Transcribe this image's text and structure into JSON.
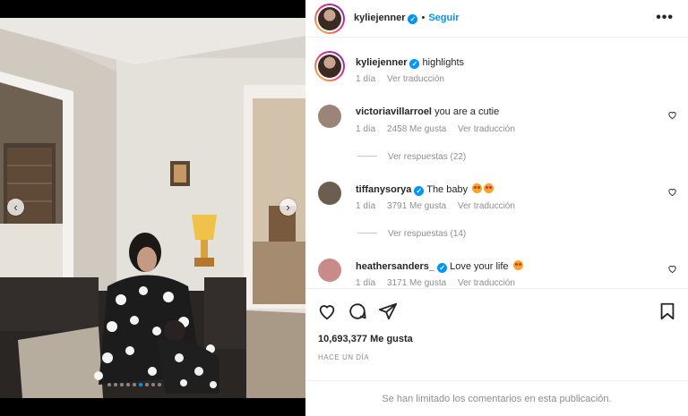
{
  "post": {
    "username": "kyliejenner",
    "follow_label": "Seguir",
    "separator": "•",
    "more_label": "•••",
    "caption": "highlights",
    "caption_time": "1 día",
    "translate_label": "Ver traducción"
  },
  "comments": [
    {
      "username": "victoriavillarroel",
      "verified": false,
      "text": "you are a cutie",
      "time": "1 día",
      "likes": "2458 Me gusta",
      "translate": "Ver traducción",
      "replies": "Ver respuestas (22)",
      "avatar_color": "#9b8578"
    },
    {
      "username": "tiffanysorya",
      "verified": true,
      "text": "The baby",
      "time": "1 día",
      "likes": "3791 Me gusta",
      "translate": "Ver traducción",
      "replies": "Ver respuestas (14)",
      "avatar_color": "#6b5d4f"
    },
    {
      "username": "heathersanders_",
      "verified": true,
      "text": "Love your life",
      "time": "1 día",
      "likes": "3171 Me gusta",
      "translate": "Ver traducción",
      "avatar_color": "#c98a8a"
    }
  ],
  "stats": {
    "likes": "10,693,377 Me gusta",
    "posted": "HACE UN DÍA"
  },
  "footer": {
    "limited": "Se han limitado los comentarios en esta publicación."
  },
  "carousel": {
    "prev_label": "‹",
    "next_label": "›",
    "slide_count": 9,
    "active_index": 5
  },
  "colors": {
    "accent": "#0095f6",
    "secondary_text": "#8e8e8e"
  },
  "icons": [
    "heart-icon",
    "comment-icon",
    "share-icon",
    "bookmark-icon",
    "verified-icon",
    "more-options-icon",
    "chevron-left-icon",
    "chevron-right-icon"
  ]
}
